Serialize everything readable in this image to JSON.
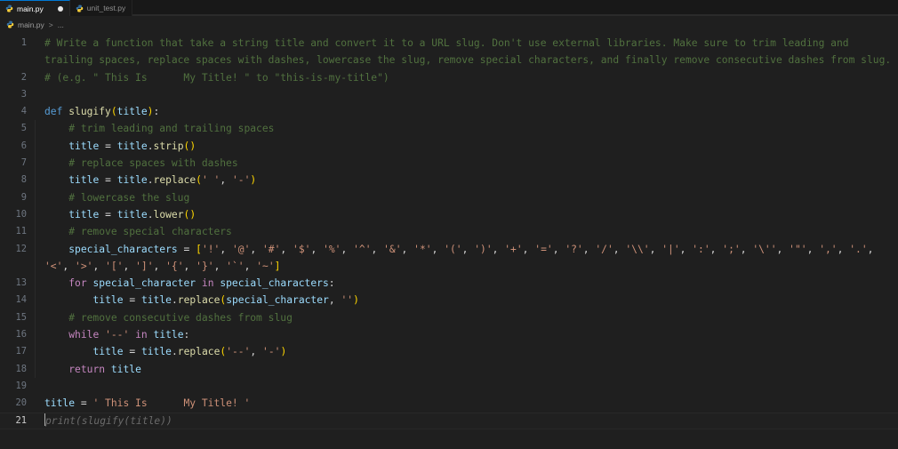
{
  "window": {
    "title": "main.py",
    "background": "#1f1f1f"
  },
  "tabs": [
    {
      "label": "main.py",
      "icon": "python-file-icon",
      "active": true,
      "dirty": true
    },
    {
      "label": "unit_test.py",
      "icon": "python-file-icon",
      "active": false,
      "dirty": false
    }
  ],
  "breadcrumb": {
    "icon": "python-file-icon",
    "file": "main.py",
    "separator": ">",
    "ellipsis": "..."
  },
  "colors": {
    "editor_background": "#1f1f1f",
    "tabbar_background": "#181818",
    "active_tab_accent": "#0078d4",
    "comment": "#51713f",
    "keyword_control": "#c586c0",
    "keyword_def": "#569cd6",
    "function": "#dcdcaa",
    "variable": "#9cdcfe",
    "string": "#ce9178",
    "bracket_level1": "#ffd700",
    "bracket_level2": "#da70d6",
    "bracket_level3": "#179fff",
    "line_number": "#6e7681",
    "line_number_active": "#cccccc",
    "ghost_text": "#6b6b6b"
  },
  "editor": {
    "language": "Python",
    "active_line": 21,
    "total_lines_visible": 21,
    "suggestion_text": "print(slugify(title))",
    "lines": [
      {
        "n": 1,
        "text": "# Write a function that take a string title and convert it to a URL slug. Don't use external libraries. Make sure to trim leading and trailing spaces, replace spaces with dashes, lowercase the slug, remove special characters, and finally remove consecutive dashes from slug."
      },
      {
        "n": 2,
        "text": "# (e.g. \" This Is      My Title! \" to \"this-is-my-title\")"
      },
      {
        "n": 3,
        "text": ""
      },
      {
        "n": 4,
        "text": "def slugify(title):"
      },
      {
        "n": 5,
        "text": "    # trim leading and trailing spaces"
      },
      {
        "n": 6,
        "text": "    title = title.strip()"
      },
      {
        "n": 7,
        "text": "    # replace spaces with dashes"
      },
      {
        "n": 8,
        "text": "    title = title.replace(' ', '-')"
      },
      {
        "n": 9,
        "text": "    # lowercase the slug"
      },
      {
        "n": 10,
        "text": "    title = title.lower()"
      },
      {
        "n": 11,
        "text": "    # remove special characters"
      },
      {
        "n": 12,
        "text": "    special_characters = ['!', '@', '#', '$', '%', '^', '&', '*', '(', ')', '+', '=', '?', '/', '\\\\', '|', ':', ';', '\\'', '\"', ',', '.', '<', '>', '[', ']', '{', '}', '`', '~']"
      },
      {
        "n": 13,
        "text": "    for special_character in special_characters:"
      },
      {
        "n": 14,
        "text": "        title = title.replace(special_character, '')"
      },
      {
        "n": 15,
        "text": "    # remove consecutive dashes from slug"
      },
      {
        "n": 16,
        "text": "    while '--' in title:"
      },
      {
        "n": 17,
        "text": "        title = title.replace('--', '-')"
      },
      {
        "n": 18,
        "text": "    return title"
      },
      {
        "n": 19,
        "text": ""
      },
      {
        "n": 20,
        "text": "title = ' This Is      My Title! '"
      },
      {
        "n": 21,
        "text": "print(slugify(title))"
      }
    ]
  }
}
